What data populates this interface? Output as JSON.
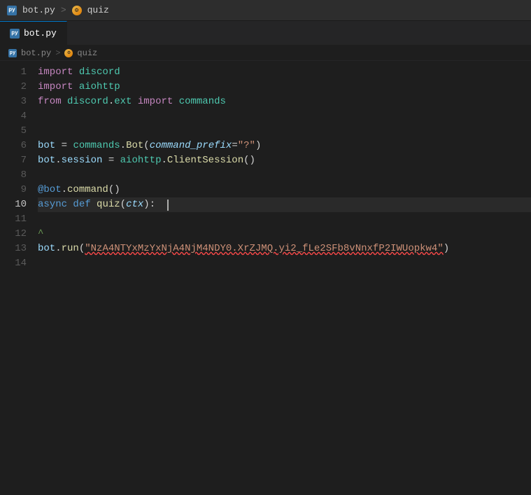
{
  "titlebar": {
    "file": "bot.py",
    "separator": ">",
    "section": "quiz"
  },
  "tabs": [
    {
      "id": "bot-py",
      "label": "bot.py",
      "icon": "python-icon",
      "active": true
    }
  ],
  "breadcrumb": {
    "file": "bot.py",
    "separator": ">",
    "symbol": "quiz"
  },
  "code": {
    "lines": [
      {
        "num": 1,
        "content": "import discord"
      },
      {
        "num": 2,
        "content": "import aiohttp"
      },
      {
        "num": 3,
        "content": "from discord.ext import commands"
      },
      {
        "num": 4,
        "content": ""
      },
      {
        "num": 5,
        "content": ""
      },
      {
        "num": 6,
        "content": "bot = commands.Bot(command_prefix=\"?\")"
      },
      {
        "num": 7,
        "content": "bot.session = aiohttp.ClientSession()"
      },
      {
        "num": 8,
        "content": ""
      },
      {
        "num": 9,
        "content": "@bot.command()"
      },
      {
        "num": 10,
        "content": "async def quiz(ctx):  |"
      },
      {
        "num": 11,
        "content": ""
      },
      {
        "num": 12,
        "content": ""
      },
      {
        "num": 13,
        "content": "bot.run(\"NzA4NTYxMzYxNjA4NjM4NDY0.XrZJMQ.yi2_fLe2SFb8vNnxfP2IWUopkw4\")"
      },
      {
        "num": 14,
        "content": ""
      }
    ]
  },
  "colors": {
    "background": "#1e1e1e",
    "activeLine": "#2a2a2a",
    "tabActive": "#1e1e1e",
    "tabInactive": "#2d2d2d",
    "keyword": "#c586c0",
    "keyword2": "#569cd6",
    "function": "#dcdcaa",
    "string": "#ce9178",
    "type": "#4ec9b0",
    "variable": "#9cdcfe",
    "decorator": "#569cd6"
  }
}
